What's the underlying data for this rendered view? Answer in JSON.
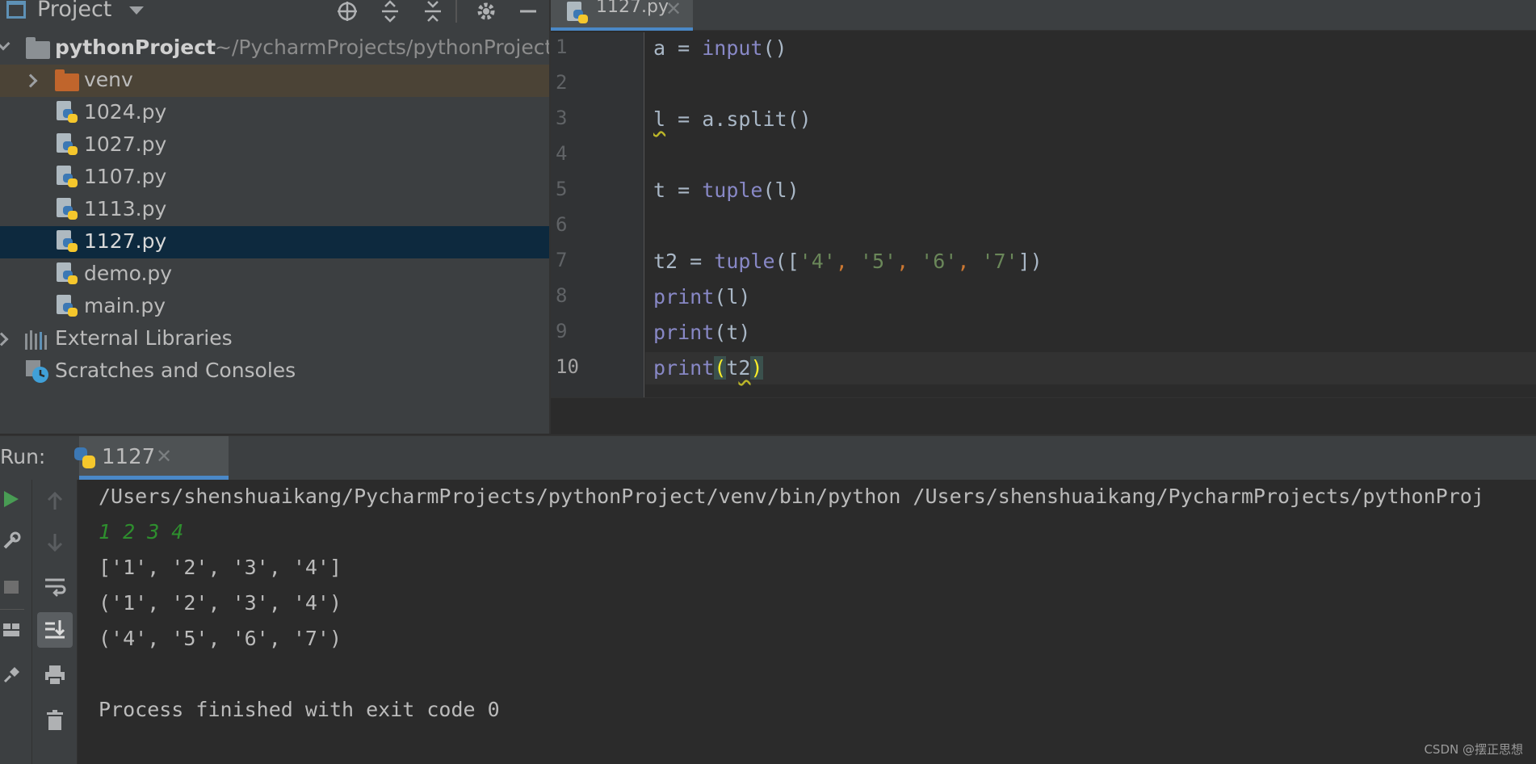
{
  "project_panel": {
    "title": "Project",
    "root": {
      "name": "pythonProject",
      "path": "~/PycharmProjects/pythonProject"
    },
    "items": [
      {
        "label": "venv",
        "kind": "folder"
      },
      {
        "label": "1024.py",
        "kind": "python-file"
      },
      {
        "label": "1027.py",
        "kind": "python-file"
      },
      {
        "label": "1107.py",
        "kind": "python-file"
      },
      {
        "label": "1113.py",
        "kind": "python-file"
      },
      {
        "label": "1127.py",
        "kind": "python-file",
        "selected": true
      },
      {
        "label": "demo.py",
        "kind": "python-file"
      },
      {
        "label": "main.py",
        "kind": "python-file"
      }
    ],
    "external_libraries": "External Libraries",
    "scratches": "Scratches and Consoles"
  },
  "editor": {
    "tab": {
      "label": "1127.py"
    },
    "line_numbers": [
      "1",
      "2",
      "3",
      "4",
      "5",
      "6",
      "7",
      "8",
      "9",
      "10"
    ],
    "current_line": "10"
  },
  "run_window": {
    "label": "Run:",
    "tab_label": "1127",
    "console": {
      "command": "/Users/shenshuaikang/PycharmProjects/pythonProject/venv/bin/python /Users/shenshuaikang/PycharmProjects/pythonProj",
      "user_input": "1 2 3 4",
      "outputs": [
        "['1', '2', '3', '4']",
        "('1', '2', '3', '4')",
        "('4', '5', '6', '7')"
      ],
      "exit_message": "Process finished with exit code 0"
    }
  },
  "watermark": "CSDN @摆正思想",
  "colors": {
    "selection": "#0d293e",
    "accent": "#4a88c7",
    "keyword": "#8888c6",
    "string": "#6a8759",
    "comma": "#cc7832",
    "console_input": "#2e8f2e"
  }
}
